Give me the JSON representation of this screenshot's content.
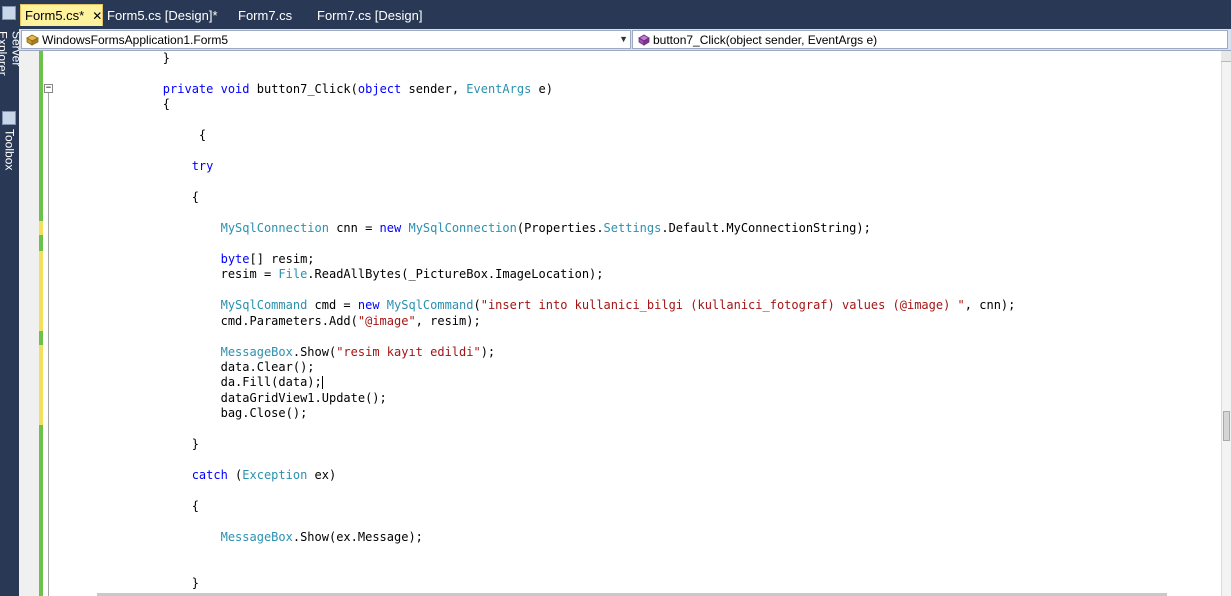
{
  "tabs": [
    {
      "label": "Form5.cs*",
      "active": true
    },
    {
      "label": "Form5.cs [Design]*",
      "active": false
    },
    {
      "label": "Form7.cs",
      "active": false
    },
    {
      "label": "Form7.cs [Design]",
      "active": false
    }
  ],
  "tab_close_glyph": "✕",
  "left_tool_windows": [
    "Server Explorer",
    "Toolbox"
  ],
  "navigation": {
    "type_dropdown": "WindowsFormsApplication1.Form5",
    "member_dropdown": "button7_Click(object sender, EventArgs e)"
  },
  "icons": {
    "class": "class-icon",
    "method": "method-icon",
    "server_explorer": "server-explorer-icon",
    "toolbox": "toolbox-icon",
    "collapse": "collapse-minus-icon"
  },
  "colors": {
    "keyword": "#0000ff",
    "type": "#2b91af",
    "string": "#a31515",
    "active_tab": "#fff29d",
    "chrome": "#293955"
  },
  "code_lines": [
    {
      "indent": "        ",
      "parts": [
        [
          "",
          "}"
        ]
      ]
    },
    {
      "indent": "",
      "parts": []
    },
    {
      "indent": "        ",
      "parts": [
        [
          "kw",
          "private"
        ],
        [
          "",
          " "
        ],
        [
          "kw",
          "void"
        ],
        [
          "",
          " button7_Click("
        ],
        [
          "kw",
          "object"
        ],
        [
          "",
          " sender, "
        ],
        [
          "ty",
          "EventArgs"
        ],
        [
          "",
          " e)"
        ]
      ]
    },
    {
      "indent": "        ",
      "parts": [
        [
          "",
          "{"
        ]
      ]
    },
    {
      "indent": "",
      "parts": []
    },
    {
      "indent": "             ",
      "parts": [
        [
          "",
          "{"
        ]
      ]
    },
    {
      "indent": "",
      "parts": []
    },
    {
      "indent": "            ",
      "parts": [
        [
          "kw",
          "try"
        ]
      ]
    },
    {
      "indent": "",
      "parts": []
    },
    {
      "indent": "            ",
      "parts": [
        [
          "",
          "{"
        ]
      ]
    },
    {
      "indent": "",
      "parts": []
    },
    {
      "indent": "                ",
      "parts": [
        [
          "ty",
          "MySqlConnection"
        ],
        [
          "",
          " cnn = "
        ],
        [
          "kw",
          "new"
        ],
        [
          "",
          " "
        ],
        [
          "ty",
          "MySqlConnection"
        ],
        [
          "",
          "(Properties."
        ],
        [
          "ty",
          "Settings"
        ],
        [
          "",
          ".Default.MyConnectionString);"
        ]
      ]
    },
    {
      "indent": "",
      "parts": []
    },
    {
      "indent": "                ",
      "parts": [
        [
          "kw",
          "byte"
        ],
        [
          "",
          "[] resim;"
        ]
      ]
    },
    {
      "indent": "                ",
      "parts": [
        [
          "",
          "resim = "
        ],
        [
          "ty",
          "File"
        ],
        [
          "",
          ".ReadAllBytes(_PictureBox.ImageLocation);"
        ]
      ]
    },
    {
      "indent": "",
      "parts": []
    },
    {
      "indent": "                ",
      "parts": [
        [
          "ty",
          "MySqlCommand"
        ],
        [
          "",
          " cmd = "
        ],
        [
          "kw",
          "new"
        ],
        [
          "",
          " "
        ],
        [
          "ty",
          "MySqlCommand"
        ],
        [
          "",
          "("
        ],
        [
          "st",
          "\"insert into kullanici_bilgi (kullanici_fotograf) values (@image) \""
        ],
        [
          "",
          ", cnn);"
        ]
      ]
    },
    {
      "indent": "                ",
      "parts": [
        [
          "",
          "cmd.Parameters.Add("
        ],
        [
          "st",
          "\"@image\""
        ],
        [
          "",
          ", resim);"
        ]
      ]
    },
    {
      "indent": "",
      "parts": []
    },
    {
      "indent": "                ",
      "parts": [
        [
          "ty",
          "MessageBox"
        ],
        [
          "",
          ".Show("
        ],
        [
          "st",
          "\"resim kayıt edildi\""
        ],
        [
          "",
          ");"
        ]
      ]
    },
    {
      "indent": "                ",
      "parts": [
        [
          "",
          "data.Clear();"
        ]
      ]
    },
    {
      "indent": "                ",
      "parts": [
        [
          "",
          "da.Fill(data);"
        ]
      ],
      "caret": true
    },
    {
      "indent": "                ",
      "parts": [
        [
          "",
          "dataGridView1.Update();"
        ]
      ]
    },
    {
      "indent": "                ",
      "parts": [
        [
          "",
          "bag.Close();"
        ]
      ]
    },
    {
      "indent": "",
      "parts": []
    },
    {
      "indent": "            ",
      "parts": [
        [
          "",
          "}"
        ]
      ]
    },
    {
      "indent": "",
      "parts": []
    },
    {
      "indent": "            ",
      "parts": [
        [
          "kw",
          "catch"
        ],
        [
          "",
          " ("
        ],
        [
          "ty",
          "Exception"
        ],
        [
          "",
          " ex)"
        ]
      ]
    },
    {
      "indent": "",
      "parts": []
    },
    {
      "indent": "            ",
      "parts": [
        [
          "",
          "{"
        ]
      ]
    },
    {
      "indent": "",
      "parts": []
    },
    {
      "indent": "                ",
      "parts": [
        [
          "ty",
          "MessageBox"
        ],
        [
          "",
          ".Show(ex.Message);"
        ]
      ]
    },
    {
      "indent": "",
      "parts": []
    },
    {
      "indent": "",
      "parts": []
    },
    {
      "indent": "            ",
      "parts": [
        [
          "",
          "}"
        ]
      ]
    }
  ]
}
